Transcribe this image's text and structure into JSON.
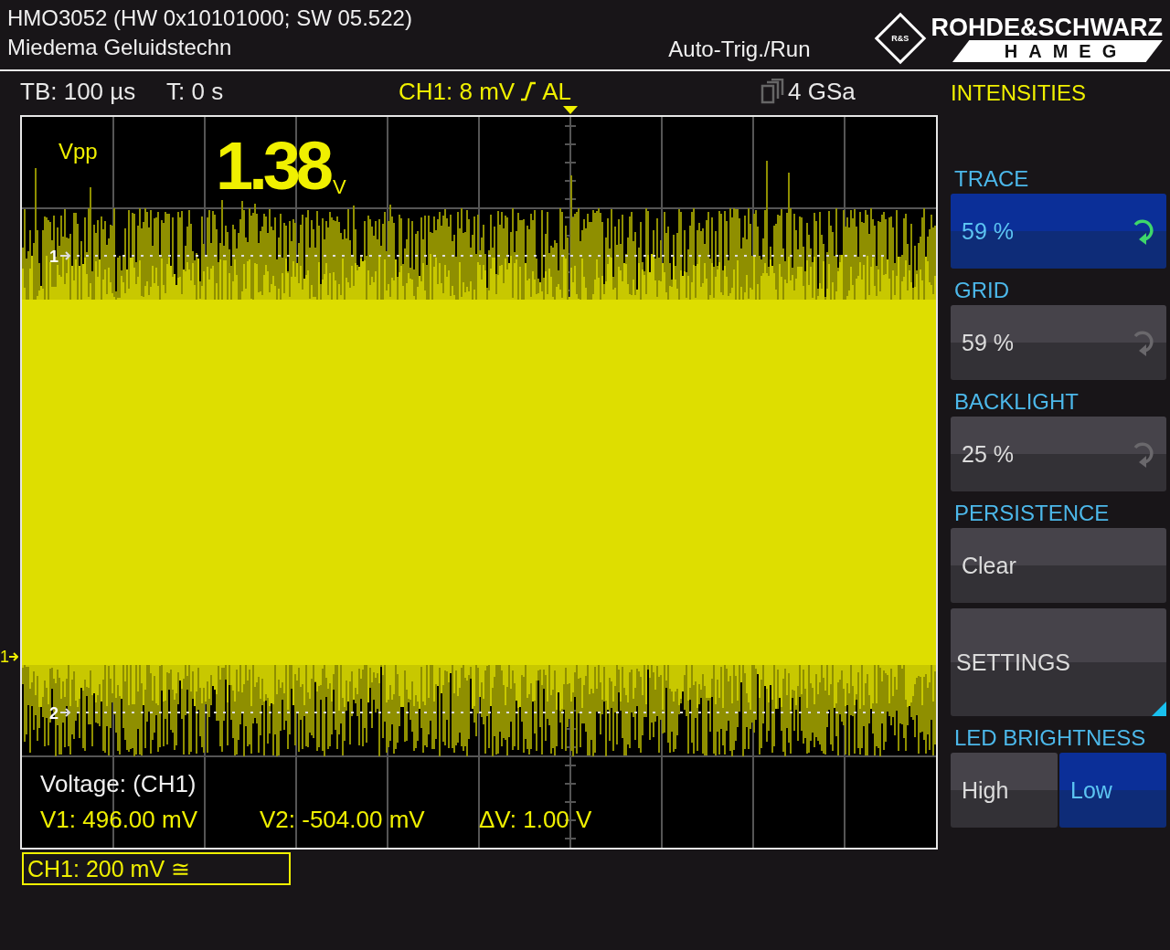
{
  "header": {
    "title": "HMO3052 (HW 0x10101000; SW 05.522)",
    "subtitle": "Miedema Geluidstechn",
    "trigger_status": "Auto-Trig./Run",
    "logo": {
      "emblem": "R&S",
      "brand": "ROHDE&SCHWARZ",
      "sub_brand": "HAMEG"
    }
  },
  "info_bar": {
    "timebase": "TB: 100 µs",
    "trigger_time": "T: 0 s",
    "trigger_source": "CH1: 8 mV",
    "trigger_coupling": "AL",
    "sample_rate": "4 GSa"
  },
  "screen": {
    "measurement": {
      "label": "Vpp",
      "value": "1.38",
      "unit": "V"
    },
    "markers": [
      {
        "label": "1"
      },
      {
        "label": "2"
      }
    ],
    "ground_marker": "1",
    "cursor_readout": {
      "title": "Voltage: (CH1)",
      "values": [
        "V1: 496.00 mV",
        "V2: -504.00 mV",
        "ΔV: 1.00 V"
      ]
    }
  },
  "channel_box": "CH1: 200 mV ≅",
  "menu": {
    "title": "INTENSITIES",
    "sections": [
      {
        "heading": "TRACE",
        "buttons": [
          {
            "kind": "value",
            "label": "59 %",
            "selected": true
          }
        ]
      },
      {
        "heading": "GRID",
        "buttons": [
          {
            "kind": "value",
            "label": "59 %",
            "selected": false
          }
        ]
      },
      {
        "heading": "BACKLIGHT",
        "buttons": [
          {
            "kind": "value",
            "label": "25 %",
            "selected": false
          }
        ]
      },
      {
        "heading": "PERSISTENCE",
        "buttons": [
          {
            "kind": "action",
            "label": "Clear",
            "selected": false
          },
          {
            "kind": "submenu",
            "label": "SETTINGS",
            "selected": false
          }
        ]
      },
      {
        "heading": "LED BRIGHTNESS",
        "buttons": [
          {
            "kind": "toggle",
            "label": "High",
            "selected": false
          },
          {
            "kind": "toggle",
            "label": "Low",
            "selected": true
          }
        ]
      }
    ]
  }
}
